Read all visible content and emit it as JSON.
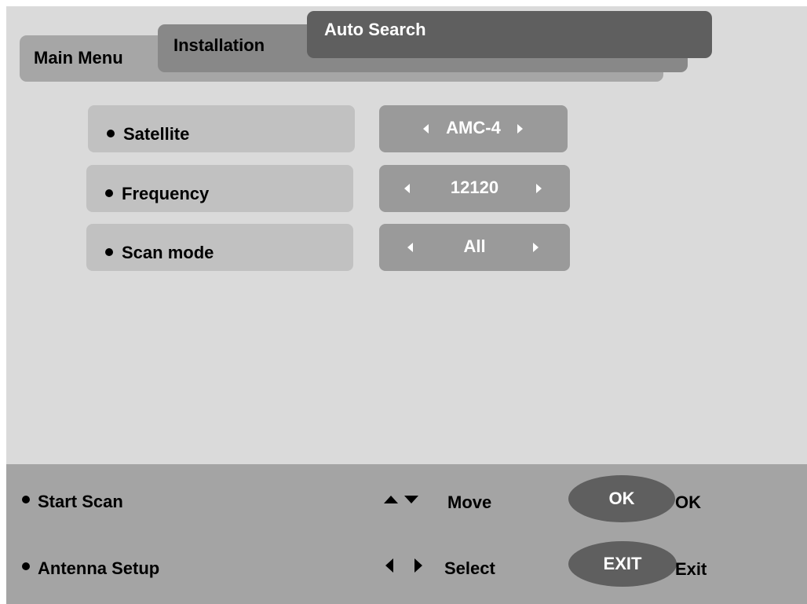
{
  "tabs": {
    "main_menu": "Main Menu",
    "installation": "Installation",
    "auto_search": "Auto Search"
  },
  "settings": [
    {
      "label": "Satellite",
      "value": "AMC-4"
    },
    {
      "label": "Frequency",
      "value": "12120"
    },
    {
      "label": "Scan mode",
      "value": "All"
    }
  ],
  "help": {
    "start_scan": "Start Scan",
    "antenna_setup": "Antenna Setup",
    "move_label": "Move",
    "select_label": "Select",
    "ok_key": "OK",
    "ok_label": "OK",
    "exit_key": "EXIT",
    "exit_label": "Exit"
  },
  "colors": {
    "screen_bg": "#dadada",
    "active_tab": "#5f5f5f",
    "value_box": "#9a9a9a",
    "label_box": "#c1c1c1",
    "help_bar": "#a4a4a4"
  },
  "icons": [
    "bullet-icon",
    "left-arrow-icon",
    "right-arrow-icon",
    "up-arrow-icon",
    "down-arrow-icon"
  ]
}
